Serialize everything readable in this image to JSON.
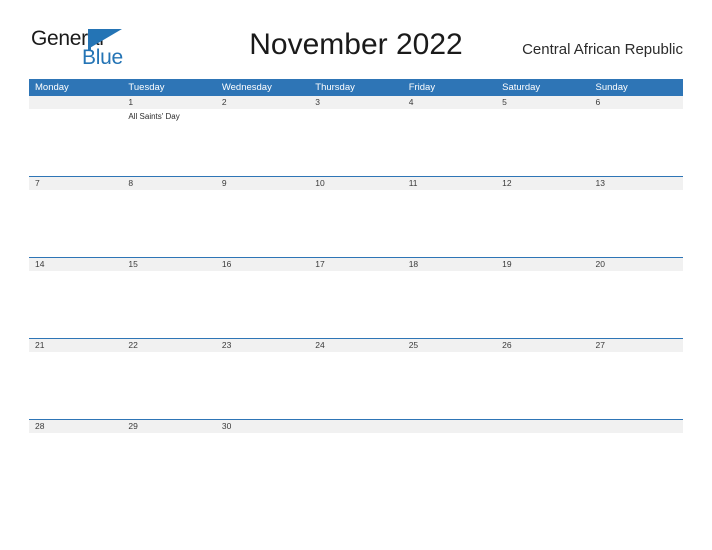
{
  "brand": {
    "name_part1": "General",
    "name_part2": "Blue",
    "flag_icon": "flag-triangle-icon",
    "accent_color": "#2474b5"
  },
  "header": {
    "title": "November 2022",
    "region": "Central African Republic"
  },
  "theme": {
    "header_blue": "#2e75b6",
    "band_gray": "#f1f1f1",
    "rule_blue": "#2e75b6",
    "text_dark": "#1a1a1a"
  },
  "calendar": {
    "month": "November",
    "year": "2022",
    "weekday_headers": [
      "Monday",
      "Tuesday",
      "Wednesday",
      "Thursday",
      "Friday",
      "Saturday",
      "Sunday"
    ],
    "weeks": [
      [
        {
          "date": "",
          "events": []
        },
        {
          "date": "1",
          "events": [
            "All Saints' Day"
          ]
        },
        {
          "date": "2",
          "events": []
        },
        {
          "date": "3",
          "events": []
        },
        {
          "date": "4",
          "events": []
        },
        {
          "date": "5",
          "events": []
        },
        {
          "date": "6",
          "events": []
        }
      ],
      [
        {
          "date": "7",
          "events": []
        },
        {
          "date": "8",
          "events": []
        },
        {
          "date": "9",
          "events": []
        },
        {
          "date": "10",
          "events": []
        },
        {
          "date": "11",
          "events": []
        },
        {
          "date": "12",
          "events": []
        },
        {
          "date": "13",
          "events": []
        }
      ],
      [
        {
          "date": "14",
          "events": []
        },
        {
          "date": "15",
          "events": []
        },
        {
          "date": "16",
          "events": []
        },
        {
          "date": "17",
          "events": []
        },
        {
          "date": "18",
          "events": []
        },
        {
          "date": "19",
          "events": []
        },
        {
          "date": "20",
          "events": []
        }
      ],
      [
        {
          "date": "21",
          "events": []
        },
        {
          "date": "22",
          "events": []
        },
        {
          "date": "23",
          "events": []
        },
        {
          "date": "24",
          "events": []
        },
        {
          "date": "25",
          "events": []
        },
        {
          "date": "26",
          "events": []
        },
        {
          "date": "27",
          "events": []
        }
      ],
      [
        {
          "date": "28",
          "events": []
        },
        {
          "date": "29",
          "events": []
        },
        {
          "date": "30",
          "events": []
        },
        {
          "date": "",
          "events": []
        },
        {
          "date": "",
          "events": []
        },
        {
          "date": "",
          "events": []
        },
        {
          "date": "",
          "events": []
        }
      ]
    ]
  }
}
